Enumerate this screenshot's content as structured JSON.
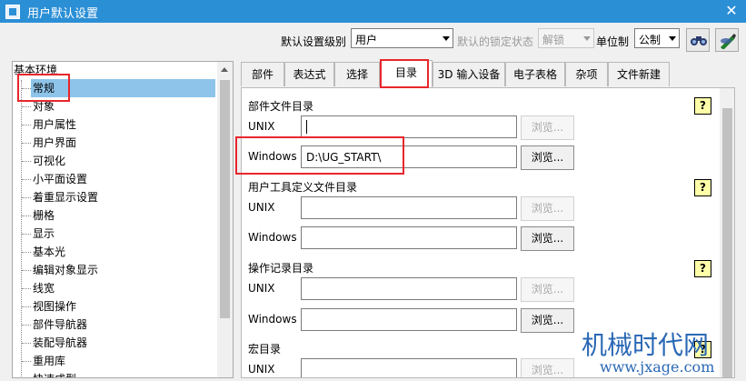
{
  "window": {
    "title": "用户默认设置",
    "accent": "#2b8fd6"
  },
  "toolbar": {
    "level_label": "默认设置级别",
    "level_value": "用户",
    "lock_label": "默认的锁定状态",
    "lock_value": "解锁",
    "unit_label": "单位制",
    "unit_value": "公制"
  },
  "tree": {
    "root": "基本环境",
    "items": [
      "常规",
      "对象",
      "用户属性",
      "用户界面",
      "可视化",
      "小平面设置",
      "着重显示设置",
      "栅格",
      "显示",
      "基本光",
      "编辑对象显示",
      "线宽",
      "视图操作",
      "部件导航器",
      "装配导航器",
      "重用库",
      "快速成型"
    ]
  },
  "tabs": [
    "部件",
    "表达式",
    "选择",
    "目录",
    "3D 输入设备",
    "电子表格",
    "杂项",
    "文件新建"
  ],
  "sections": [
    {
      "title": "部件文件目录",
      "unix_label": "UNIX",
      "unix_value": "",
      "windows_label": "Windows",
      "windows_value": "D:\\UG_START\\",
      "browse": "浏览..."
    },
    {
      "title": "用户工具定义文件目录",
      "unix_label": "UNIX",
      "unix_value": "",
      "windows_label": "Windows",
      "windows_value": "",
      "browse": "浏览..."
    },
    {
      "title": "操作记录目录",
      "unix_label": "UNIX",
      "unix_value": "",
      "windows_label": "Windows",
      "windows_value": "",
      "browse": "浏览..."
    },
    {
      "title": "宏目录",
      "unix_label": "UNIX",
      "unix_value": "",
      "browse": "浏览..."
    }
  ],
  "help_glyph": "?",
  "close_glyph": "✕",
  "watermark": {
    "text": "机械时代网",
    "url": "www.jxage.com"
  }
}
